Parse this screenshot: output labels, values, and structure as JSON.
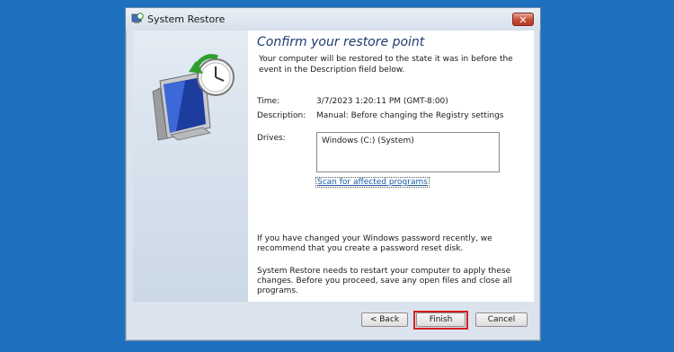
{
  "window": {
    "title": "System Restore",
    "close_label": "✕"
  },
  "content": {
    "heading": "Confirm your restore point",
    "intro": "Your computer will be restored to the state it was in before the event in the Description field below.",
    "time_label": "Time:",
    "time_value": "3/7/2023 1:20:11 PM (GMT-8:00)",
    "description_label": "Description:",
    "description_value": "Manual: Before changing the Registry settings",
    "drives_label": "Drives:",
    "drives": [
      "Windows (C:) (System)"
    ],
    "scan_link": "Scan for affected programs",
    "password_note": "If you have changed your Windows password recently, we recommend that you create a password reset disk.",
    "restart_note": "System Restore needs to restart your computer to apply these changes. Before you proceed, save any open files and close all programs."
  },
  "buttons": {
    "back": "< Back",
    "finish": "Finish",
    "cancel": "Cancel"
  },
  "colors": {
    "desktop": "#1f6fbf",
    "heading": "#1e3b6e",
    "link": "#1a5aa6",
    "highlight": "#d42020"
  },
  "icons": {
    "title": "system-restore-icon",
    "close": "close-icon",
    "side": "system-restore-computer-clock-icon"
  }
}
